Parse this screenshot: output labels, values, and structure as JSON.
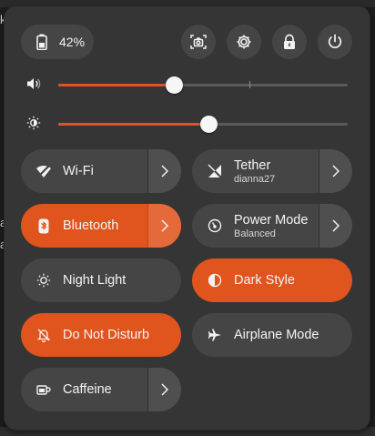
{
  "background": {
    "fragment_top": "k",
    "fragment_left_1": "a",
    "fragment_left_2": "a"
  },
  "status": {
    "battery_label": "42%"
  },
  "system_buttons": {
    "screenshot_icon": "screenshot-icon",
    "settings_icon": "gear-icon",
    "lock_icon": "lock-icon",
    "power_icon": "power-icon"
  },
  "sliders": {
    "volume": {
      "level": 0.4,
      "marker": 0.66
    },
    "brightness": {
      "level": 0.52
    }
  },
  "toggles": {
    "wifi": {
      "label": "Wi-Fi",
      "active": false
    },
    "tether": {
      "label": "Tether",
      "subtitle": "dianna27",
      "active": false
    },
    "bluetooth": {
      "label": "Bluetooth",
      "active": true
    },
    "power_mode": {
      "label": "Power Mode",
      "subtitle": "Balanced",
      "active": false
    },
    "night_light": {
      "label": "Night Light",
      "active": false
    },
    "dark_style": {
      "label": "Dark Style",
      "active": true
    },
    "do_not_disturb": {
      "label": "Do Not Disturb",
      "active": true
    },
    "airplane_mode": {
      "label": "Airplane Mode",
      "active": false
    },
    "caffeine": {
      "label": "Caffeine",
      "active": false
    }
  },
  "colors": {
    "accent": "#e0541e",
    "panel": "#353535",
    "tile": "#454545"
  }
}
